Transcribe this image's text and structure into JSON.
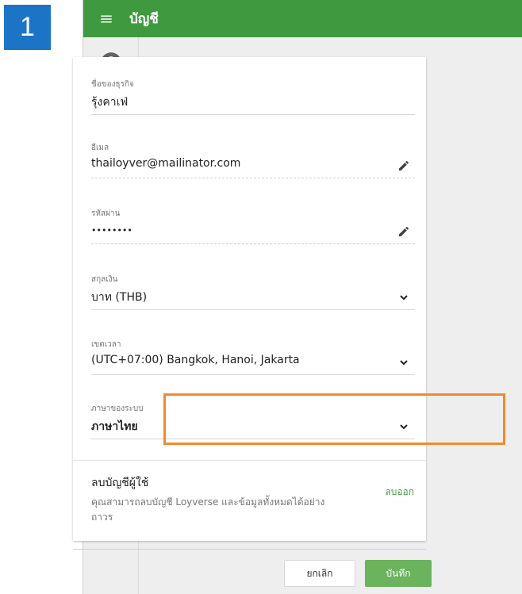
{
  "step_number": "1",
  "header": {
    "title": "บัญชี"
  },
  "sidebar": {
    "items": [
      {
        "icon": "account-circle-icon",
        "color": "#616161"
      },
      {
        "icon": "bar-chart-icon",
        "color": "#43a047"
      },
      {
        "icon": "shopping-basket-icon",
        "color": "#e91e63"
      },
      {
        "icon": "items-cart-icon",
        "color": "#00897b"
      },
      {
        "icon": "customer-card-icon",
        "color": "#1e8e3e"
      },
      {
        "icon": "employees-icon",
        "color": "#3f51b5"
      },
      {
        "icon": "integrations-puzzle-icon",
        "color": "#6d4c41"
      },
      {
        "icon": "settings-gear-icon",
        "color": "#546e7a"
      },
      {
        "icon": "help-icon",
        "color": "#1e88e5"
      }
    ]
  },
  "form": {
    "business_name": {
      "label": "ชื่อของธุรกิจ",
      "value": "รุ้งคาเฟ่"
    },
    "email": {
      "label": "อีเมล",
      "value": "thailoyver@mailinator.com"
    },
    "password": {
      "label": "รหัสผ่าน",
      "value": "••••••••"
    },
    "currency": {
      "label": "สกุลเงิน",
      "value": "บาท (THB)"
    },
    "timezone": {
      "label": "เขตเวลา",
      "value": "(UTC+07:00) Bangkok, Hanoi, Jakarta"
    },
    "language": {
      "label": "ภาษาของระบบ",
      "value": "ภาษาไทย"
    }
  },
  "delete_account": {
    "title": "ลบบัญชีผู้ใช้",
    "description": "คุณสามารถลบบัญชี Loyverse และข้อมูลทั้งหมดได้อย่างถาวร",
    "action": "ลบออก"
  },
  "buttons": {
    "cancel": "ยกเลิก",
    "save": "บันทึก"
  },
  "colors": {
    "header": "#3f9a3f",
    "highlight": "#f28a2c",
    "badge": "#1b74c5",
    "save": "#6bb35c"
  }
}
